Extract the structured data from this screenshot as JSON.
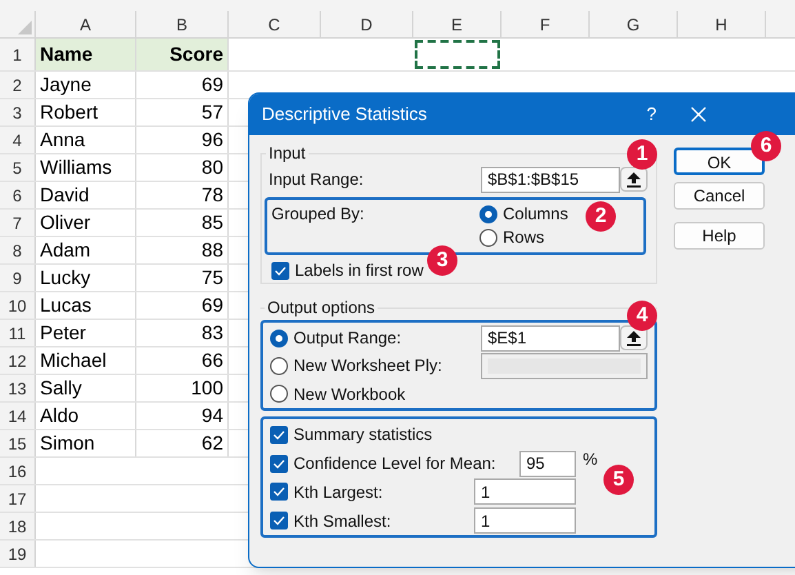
{
  "sheet": {
    "columns": [
      {
        "label": "A"
      },
      {
        "label": "B"
      },
      {
        "label": "C"
      },
      {
        "label": "D"
      },
      {
        "label": "E"
      },
      {
        "label": "F"
      },
      {
        "label": "G"
      },
      {
        "label": "H"
      }
    ],
    "copy_marquee": true,
    "rows": [
      {
        "number": "1",
        "kind": "header",
        "name": "Name",
        "score": "Score"
      },
      {
        "number": "2",
        "kind": "data",
        "name": "Jayne",
        "score": "69"
      },
      {
        "number": "3",
        "kind": "data",
        "name": "Robert",
        "score": "57"
      },
      {
        "number": "4",
        "kind": "data",
        "name": "Anna",
        "score": "96"
      },
      {
        "number": "5",
        "kind": "data",
        "name": "Williams",
        "score": "80"
      },
      {
        "number": "6",
        "kind": "data",
        "name": "David",
        "score": "78"
      },
      {
        "number": "7",
        "kind": "data",
        "name": "Oliver",
        "score": "85"
      },
      {
        "number": "8",
        "kind": "data",
        "name": "Adam",
        "score": "88"
      },
      {
        "number": "9",
        "kind": "data",
        "name": "Lucky",
        "score": "75"
      },
      {
        "number": "10",
        "kind": "data",
        "name": "Lucas",
        "score": "69"
      },
      {
        "number": "11",
        "kind": "data",
        "name": "Peter",
        "score": "83"
      },
      {
        "number": "12",
        "kind": "data",
        "name": "Michael",
        "score": "66"
      },
      {
        "number": "13",
        "kind": "data",
        "name": "Sally",
        "score": "100"
      },
      {
        "number": "14",
        "kind": "data",
        "name": "Aldo",
        "score": "94"
      },
      {
        "number": "15",
        "kind": "data",
        "name": "Simon",
        "score": "62"
      },
      {
        "number": "16",
        "kind": "empty"
      },
      {
        "number": "17",
        "kind": "empty"
      },
      {
        "number": "18",
        "kind": "empty"
      },
      {
        "number": "19",
        "kind": "empty"
      }
    ]
  },
  "dialog": {
    "title": "Descriptive Statistics",
    "help": "?",
    "input": {
      "legend": "Input",
      "range_label": "Input Range:",
      "range_value": "$B$1:$B$15",
      "grouped_label": "Grouped By:",
      "grouped_options": [
        {
          "label": "Columns",
          "selected": true
        },
        {
          "label": "Rows",
          "selected": false
        }
      ],
      "labels_checkbox": {
        "label": "Labels in first row",
        "checked": true
      }
    },
    "output": {
      "legend": "Output options",
      "options": [
        {
          "kind": "field",
          "label": "Output Range:",
          "selected": true,
          "value": "$E$1",
          "enabled": true
        },
        {
          "kind": "field",
          "label": "New Worksheet Ply:",
          "selected": false,
          "enabled": false
        },
        {
          "kind": "plain",
          "label": "New Workbook",
          "selected": false
        }
      ]
    },
    "stats": [
      {
        "kind": "plain",
        "label": "Summary statistics",
        "checked": true
      },
      {
        "kind": "percent",
        "label": "Confidence Level for Mean:",
        "checked": true,
        "value": "95",
        "suffix": "%"
      },
      {
        "kind": "field",
        "label": "Kth Largest:",
        "checked": true,
        "value": "1"
      },
      {
        "kind": "field",
        "label": "Kth Smallest:",
        "checked": true,
        "value": "1"
      }
    ],
    "buttons": [
      {
        "label": "OK",
        "default": true
      },
      {
        "label": "Cancel",
        "default": false
      },
      {
        "label": "Help",
        "default": false
      }
    ]
  },
  "callouts": [
    {
      "label": "1"
    },
    {
      "label": "2"
    },
    {
      "label": "3"
    },
    {
      "label": "4"
    },
    {
      "label": "5"
    },
    {
      "label": "6"
    }
  ]
}
